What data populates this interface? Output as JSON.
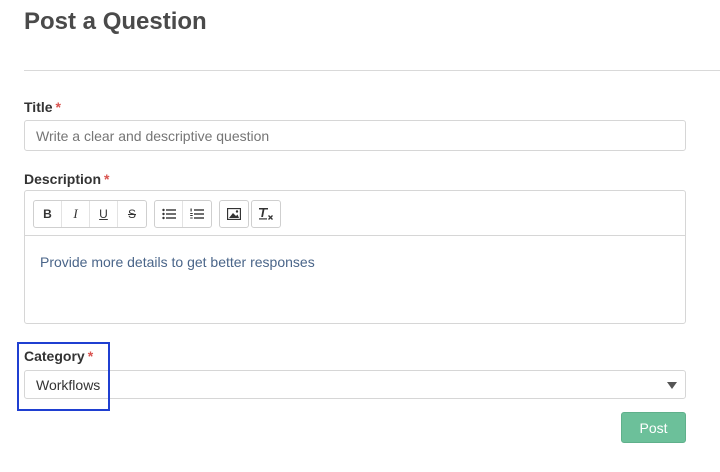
{
  "page": {
    "title": "Post a Question"
  },
  "form": {
    "title_field": {
      "label": "Title",
      "required_mark": "*",
      "placeholder": "Write a clear and descriptive question"
    },
    "description_field": {
      "label": "Description",
      "required_mark": "*",
      "placeholder": "Provide more details to get better responses",
      "toolbar": {
        "bold": "B",
        "italic": "I",
        "underline": "U",
        "strike": "S"
      }
    },
    "category_field": {
      "label": "Category",
      "required_mark": "*",
      "selected_value": "Workflows"
    },
    "submit_label": "Post"
  },
  "colors": {
    "accent": "#6cc09a",
    "required": "#d9534f",
    "highlight": "#1f3fd1"
  },
  "icons": [
    "bullet-list-icon",
    "numbered-list-icon",
    "image-icon",
    "clear-format-icon",
    "chevron-down-icon"
  ]
}
